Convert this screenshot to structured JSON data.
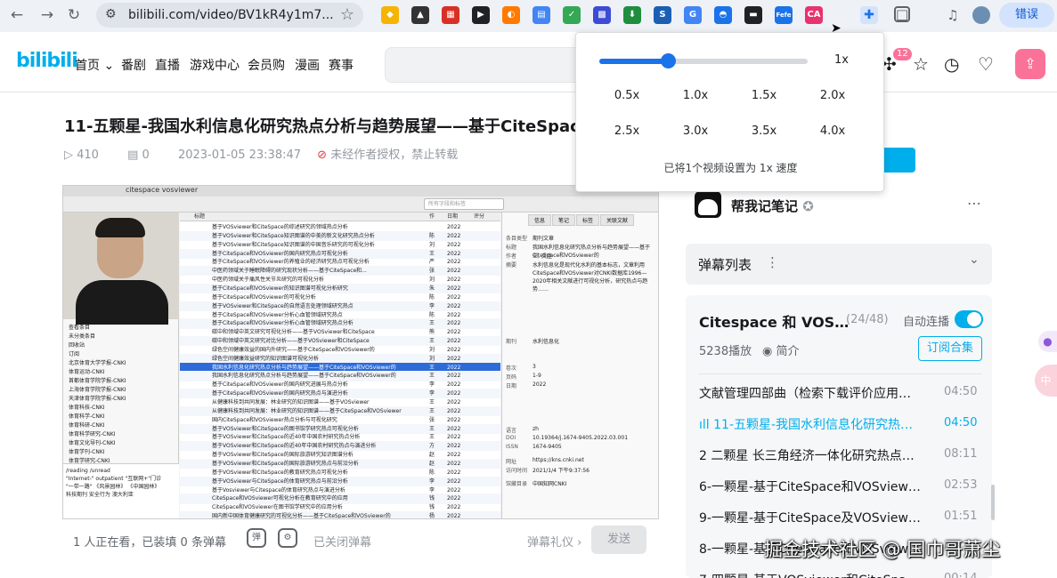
{
  "browser": {
    "url": "bilibili.com/video/BV1kR4y1m7...",
    "error_button": "错误",
    "extensions": [
      {
        "name": "ext-1",
        "color": "#f4b400",
        "glyph": "◆"
      },
      {
        "name": "ext-2",
        "color": "#333333",
        "glyph": "▲"
      },
      {
        "name": "ext-3",
        "color": "#d93025",
        "glyph": "▦"
      },
      {
        "name": "ext-4",
        "color": "#202124",
        "glyph": "▶"
      },
      {
        "name": "ext-5",
        "color": "#ff7a00",
        "glyph": "◐"
      },
      {
        "name": "ext-6",
        "color": "#4285f4",
        "glyph": "▤"
      },
      {
        "name": "ext-7",
        "color": "#34a853",
        "glyph": "✓"
      },
      {
        "name": "ext-8",
        "color": "#3c4cd6",
        "glyph": "▩"
      },
      {
        "name": "ext-9",
        "color": "#1e8e3e",
        "glyph": "⬇"
      },
      {
        "name": "ext-10",
        "color": "#1a5fb4",
        "glyph": "S"
      },
      {
        "name": "ext-11",
        "color": "#4285f4",
        "glyph": "G"
      },
      {
        "name": "ext-12",
        "color": "#1a73e8",
        "glyph": "◓"
      },
      {
        "name": "ext-13",
        "color": "#202124",
        "glyph": "▬"
      },
      {
        "name": "ext-14",
        "color": "#1a73e8",
        "glyph": "Fefe"
      },
      {
        "name": "ext-15",
        "color": "#e8336d",
        "glyph": "CA"
      }
    ]
  },
  "nav": {
    "logo": "bilibili",
    "items": [
      "首页",
      "番剧",
      "直播",
      "游戏中心",
      "会员购",
      "漫画",
      "赛事"
    ],
    "dropdown_arrow": "⌄",
    "notification_count": "12"
  },
  "video": {
    "title": "11-五颗星-我国水利信息化研究热点分析与趋势展望——基于CiteSpace",
    "views": "410",
    "danmaku": "0",
    "datetime": "2023-01-05 23:38:47",
    "rights": "未经作者授权，禁止转载"
  },
  "player_content": {
    "window_title": "citespace vosviewer",
    "search_placeholder": "所有字段和标签",
    "col_title": "标题",
    "col_author": "作",
    "col_year": "日期",
    "col_rating": "评分",
    "tree": [
      "查看条目",
      "未分类条目",
      "回收站",
      "订阅",
      "北京体育大学学报-CNKI",
      "体育运动-CNKI",
      "首都体育学院学报-CNKI",
      "上海体育学院学报-CNKI",
      "天津体育学院学报-CNKI",
      "体育科技-CNKI",
      "体育科学-CNKI",
      "体育科研-CNKI",
      "体育科学研究-CNKI",
      "体育文化导刊-CNKI",
      "体育学刊-CNKI",
      "体育学研究-CNKI"
    ],
    "rows": [
      {
        "t": "基于VOSviewer和CiteSpace的综述研究的领域热点分析",
        "a": "",
        "y": "2022"
      },
      {
        "t": "基于VOSviewer和CiteSpace知识图谱的中美的新文化研究热点分析",
        "a": "陈",
        "y": "2022"
      },
      {
        "t": "基于VOSviewer和CiteSpace知识图谱的中国音乐研究的可视化分析",
        "a": "刘",
        "y": "2022"
      },
      {
        "t": "基于CiteSpace和VOSviewer的国内研究热点可视化分析",
        "a": "王",
        "y": "2022"
      },
      {
        "t": "基于CiteSpace和VOSviewer的养殖业的经济研究热点可视化分析",
        "a": "严",
        "y": "2022"
      },
      {
        "t": "中医药领域关于睡眠障碍的研究现状分析——基于CiteSpace和...",
        "a": "张",
        "y": "2022"
      },
      {
        "t": "中医药领域关于痛风性关节炎研究的可视化分析",
        "a": "刘",
        "y": "2022"
      },
      {
        "t": "基于CiteSpace和VOSviewer的知识图谱可视化分析研究",
        "a": "朱",
        "y": "2022"
      },
      {
        "t": "基于CiteSpace和VOSviewer的可视化分析",
        "a": "陈",
        "y": "2022"
      },
      {
        "t": "基于VOSviewer和CiteSpace的自然语言处理领域研究热点",
        "a": "李",
        "y": "2022"
      },
      {
        "t": "基于CiteSpace和VOSviewer分析心血管领域研究热点",
        "a": "陈",
        "y": "2022"
      },
      {
        "t": "基于CiteSpace和VOSviewer分析心血管领域研究热点分析",
        "a": "王",
        "y": "2022"
      },
      {
        "t": "碳中和领域中英文研究可视化分析——基于VOSviewer和CiteSpace",
        "a": "熊",
        "y": "2022"
      },
      {
        "t": "碳中和领域中英文研究对比分析——基于VOSviewer和CiteSpace",
        "a": "王",
        "y": "2022"
      },
      {
        "t": "绿色空间健康效益的国内外研究——基于CiteSpace和VOSviewer的",
        "a": "刘",
        "y": "2022"
      },
      {
        "t": "绿色空间健康效益研究的知识图谱可视化分析",
        "a": "刘",
        "y": "2022"
      },
      {
        "t": "我国水利信息化研究热点分析与趋势展望——基于CiteSpace和VOSviewer的",
        "a": "王",
        "y": "2022"
      },
      {
        "t": "我国水利信息化研究热点分析与趋势展望——基于CiteSpace和VOSviewer的",
        "a": "王",
        "y": "2022"
      },
      {
        "t": "基于CiteSpace和VOSviewer的国内研究进展与热点分析",
        "a": "李",
        "y": "2022"
      },
      {
        "t": "基于CiteSpace和VOSviewer的国内研究热点与演进分析",
        "a": "李",
        "y": "2022"
      },
      {
        "t": "从健康科技到共同发展：林业研究的知识图谱——基于VOSviewer",
        "a": "王",
        "y": "2022"
      },
      {
        "t": "从健康科技到共同发展：林业研究的知识图谱——基于CiteSpace和VOSviewer",
        "a": "王",
        "y": "2022"
      },
      {
        "t": "国内CiteSpace和VOSviewer热点分析与可视化研究",
        "a": "张",
        "y": "2022"
      },
      {
        "t": "基于VOSviewer和CiteSpace的图书馆学研究热点可视化分析",
        "a": "王",
        "y": "2022"
      },
      {
        "t": "基于VOSviewer和CiteSpace的近40年中国农村研究热点分析",
        "a": "王",
        "y": "2022"
      },
      {
        "t": "基于VOSviewer和CiteSpace的近40年中国农村研究热点与演进分析",
        "a": "方",
        "y": "2022"
      },
      {
        "t": "基于VOSviewer和CiteSpace的国际旅游研究知识图谱分析",
        "a": "赵",
        "y": "2022"
      },
      {
        "t": "基于VOSviewer和CiteSpace的国际旅游研究热点与前沿分析",
        "a": "赵",
        "y": "2022"
      },
      {
        "t": "基于VOSviewer和CiteSpace的教育研究热点可视化分析",
        "a": "陈",
        "y": "2022"
      },
      {
        "t": "基于VOSviewer与CiteSpace的体育研究热点与前沿分析",
        "a": "李",
        "y": "2022"
      },
      {
        "t": "基于Vosviewer与Citespace的体育研究热点与演进分析",
        "a": "李",
        "y": "2022"
      },
      {
        "t": "CiteSpace和VOSviewer可视化分析在教育研究中的应用",
        "a": "钱",
        "y": "2022"
      },
      {
        "t": "CiteSpace和VOSviewer在图书馆学研究中的应用分析",
        "a": "钱",
        "y": "2022"
      },
      {
        "t": "国内新中国体育健康研究的可视化分析——基于CiteSpace和VOSviewer的",
        "a": "杨",
        "y": "2022"
      }
    ],
    "selected_row": 16,
    "right_tabs": [
      "信息",
      "笔记",
      "标签",
      "关联文献"
    ],
    "fields": [
      {
        "k": "条目类型",
        "v": "期刊文章"
      },
      {
        "k": "标题",
        "v": "我国水利信息化研究热点分析与趋势展望——基于CiteSpace和VOSviewer的"
      },
      {
        "k": "作者",
        "v": "王, 文佳"
      },
      {
        "k": "摘要",
        "v": "水利信息化是现代化水利的基本标志，文章利用CiteSpace和VOSviewer对CNKI数据库1996—2020年相关文献进行可视化分析，研究热点与趋势……"
      },
      {
        "k": "期刊",
        "v": "水利信息化"
      },
      {
        "k": "卷次",
        "v": "3"
      },
      {
        "k": "页码",
        "v": "1-9"
      },
      {
        "k": "日期",
        "v": "2022"
      },
      {
        "k": "语言",
        "v": "zh"
      },
      {
        "k": "DOI",
        "v": "10.19364/j.1674-9405.2022.03.001"
      },
      {
        "k": "ISSN",
        "v": "1674-9405"
      },
      {
        "k": "网址",
        "v": "https://kns.cnki.net"
      },
      {
        "k": "访问时间",
        "v": "2021/1/4 下午9:37:56"
      },
      {
        "k": "馆藏目录",
        "v": "中国知网CNKI"
      }
    ],
    "notes": "/reading  /unread\n\"Internet-\" outpatient \"互联网+\"门诊\n\"一带一路\" 《风景园林》 《中国园林》\n科技期刊  安全行为  澳大利亚"
  },
  "below_player": {
    "viewers": "1 人正在看，已装填 0 条弹幕",
    "danmaku_off": "已关闭弹幕",
    "etiquette": "弹幕礼仪 ›",
    "send": "发送"
  },
  "sidebar": {
    "note_name": "帮我记笔记",
    "danmaku_list": "弹幕列表",
    "playlist_title": "Citespace 和 VOS…",
    "playlist_count": "(24/48)",
    "autoplay_label": "自动连播",
    "plays": "5238播放",
    "intro": "简介",
    "subscribe": "订阅合集",
    "items": [
      {
        "name": "文献管理四部曲（检索下载评价应用…",
        "duration": "04:50"
      },
      {
        "name": "11-五颗星-我国水利信息化研究热…",
        "duration": "04:50"
      },
      {
        "name": "2 二颗星 长三角经济一体化研究热点…",
        "duration": "08:11"
      },
      {
        "name": "6-一颗星-基于CiteSpace和VOSview…",
        "duration": "02:53"
      },
      {
        "name": "9-一颗星-基于CiteSpace及VOSview…",
        "duration": "01:51"
      },
      {
        "name": "8-一颗星-基于CiteSpace和VOSview…",
        "duration": "03:13"
      },
      {
        "name": "7-四颗星-基于VOSviewer和CiteSpa…",
        "duration": "00:14"
      }
    ],
    "active_index": 1,
    "playing_icon": "ıll",
    "watermark": "掘金技术社区 @ 国巾哥萧尘"
  },
  "speed_popup": {
    "current": "1x",
    "current_value": 1.0,
    "min": 0.5,
    "max": 4.0,
    "options": [
      "0.5x",
      "1.0x",
      "1.5x",
      "2.0x",
      "2.5x",
      "3.0x",
      "3.5x",
      "4.0x"
    ],
    "status": "已将1个视频设置为 1x 速度"
  },
  "colors": {
    "brand": "#00aeec",
    "pink": "#fb7299",
    "slider": "#1a73e8"
  }
}
